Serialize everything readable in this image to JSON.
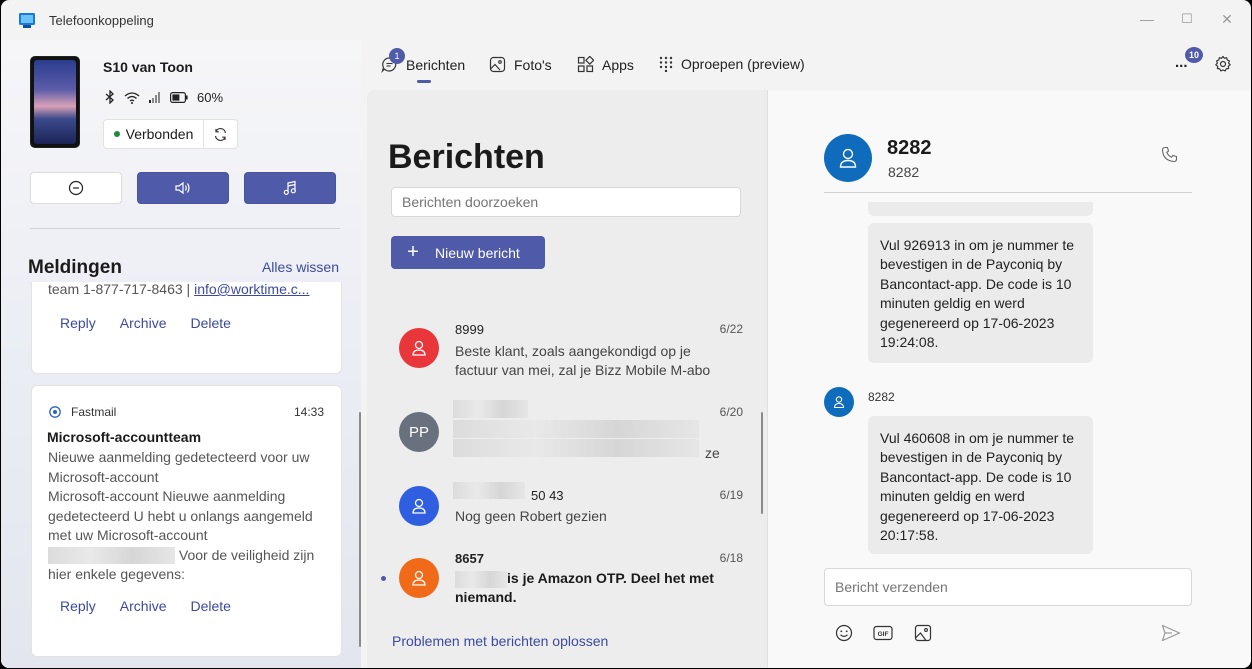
{
  "window": {
    "title": "Telefoonkoppeling",
    "minimize": "—",
    "maximize": "☐",
    "close": "✕"
  },
  "device": {
    "name": "S10 van Toon",
    "battery": "60%",
    "status": "Verbonden"
  },
  "notifications": {
    "title": "Meldingen",
    "clear_all": "Alles wissen",
    "partial_card": {
      "body": "team 1-877-717-8463 | ",
      "link": "info@worktime.c...",
      "actions": [
        "Reply",
        "Archive",
        "Delete"
      ]
    },
    "card": {
      "app": "Fastmail",
      "time": "14:33",
      "heading": "Microsoft-accountteam",
      "lines": [
        "Nieuwe aanmelding gedetecteerd voor uw",
        "Microsoft-account",
        "Microsoft-account Nieuwe aanmelding",
        "gedetecteerd U hebt u onlangs aangemeld",
        "met uw Microsoft-account",
        " Voor de veiligheid zijn",
        "hier enkele gegevens:"
      ],
      "actions": [
        "Reply",
        "Archive",
        "Delete"
      ]
    }
  },
  "tabs": {
    "messages": {
      "label": "Berichten",
      "badge": "1"
    },
    "photos": {
      "label": "Foto's"
    },
    "apps": {
      "label": "Apps"
    },
    "calls": {
      "label": "Oproepen (preview)"
    },
    "more_badge": "10",
    "more": "..."
  },
  "messages": {
    "title": "Berichten",
    "search_placeholder": "Berichten doorzoeken",
    "new_message": "Nieuw bericht",
    "fix_link": "Problemen met berichten oplossen",
    "conversations": [
      {
        "name": "8999",
        "date": "6/22",
        "preview": "Beste klant, zoals aangekondigd op je factuur van mei, zal je Bizz Mobile M-abo",
        "color": "#e8363a"
      },
      {
        "initials": "PP",
        "date": "6/20",
        "preview_tail": "ze",
        "color": "#69707e"
      },
      {
        "name_tail": "50 43",
        "date": "6/19",
        "preview": "Nog geen Robert gezien",
        "color": "#2f5fe0"
      },
      {
        "name": "8657",
        "date": "6/18",
        "preview_tail": "is je Amazon OTP. Deel het met",
        "preview_line2": "niemand.",
        "color": "#f06a1a"
      }
    ]
  },
  "conversation": {
    "name": "8282",
    "number": "8282",
    "messages": [
      {
        "text": "Vul 926913 in om je nummer te bevestigen in de Payconiq by Bancontact-app. De code is 10 minuten geldig en werd gegenereerd op 17-06-2023 19:24:08."
      },
      {
        "sender": "8282",
        "text": "Vul 460608 in om je nummer te bevestigen in de Payconiq by Bancontact-app. De code is 10 minuten geldig en werd gegenereerd op 17-06-2023 20:17:58."
      }
    ],
    "compose_placeholder": "Bericht verzenden"
  },
  "colors": {
    "accent": "#4f5aa8",
    "link": "#3b4aa0",
    "avatar_blue": "#0f6cbd"
  }
}
